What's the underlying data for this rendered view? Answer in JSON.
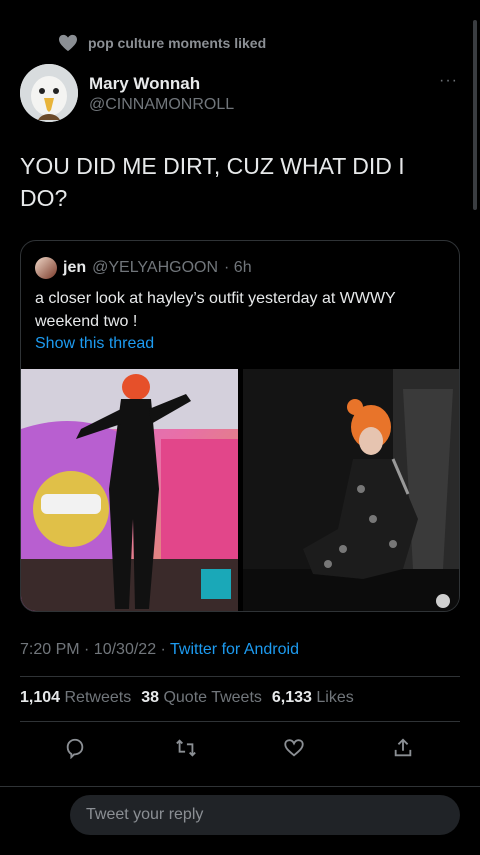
{
  "social_context": {
    "text": "pop culture moments liked",
    "icon": "heart-icon"
  },
  "tweet": {
    "author_name": "Mary Wonnah",
    "author_handle": "@CINNAMONROLL",
    "more_label": "···",
    "text": "YOU DID ME DIRT, CUZ WHAT DID I DO?",
    "timestamp": "7:20 PM · 10/30/22 · ",
    "source": "Twitter for Android",
    "stats": {
      "retweets_count": "1,104",
      "retweets_label": "Retweets",
      "quotes_count": "38",
      "quotes_label": "Quote Tweets",
      "likes_count": "6,133",
      "likes_label": "Likes"
    }
  },
  "quoted_tweet": {
    "author_name": "jen",
    "author_handle": "@YELYAHGOON",
    "time": "· 6h",
    "text": "a closer look at hayley’s outfit yesterday at WWWY weekend two !",
    "thread_link": "Show this thread"
  },
  "actions": [
    "reply-icon",
    "retweet-icon",
    "like-icon",
    "share-icon"
  ],
  "reply_box": {
    "placeholder": "Tweet your reply"
  },
  "colors": {
    "background": "#000000",
    "accent": "#1d9bf0",
    "text": "#e7e9ea",
    "muted": "#71767b"
  }
}
